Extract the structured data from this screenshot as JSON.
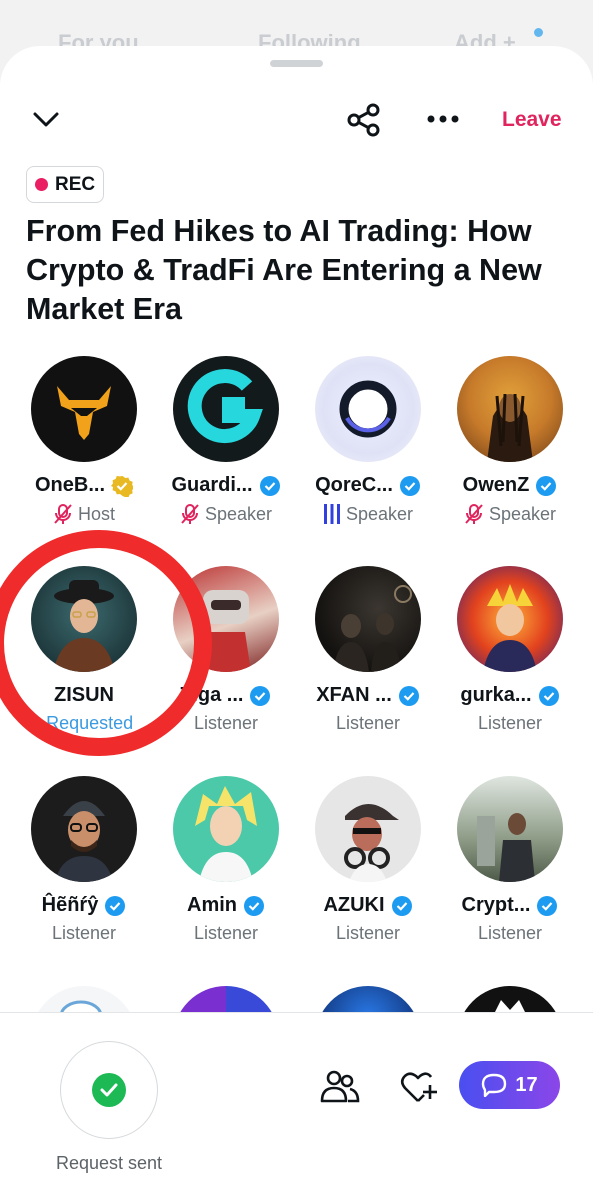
{
  "top_tabs": [
    "For you",
    "Following",
    "Add +"
  ],
  "header": {
    "leave_label": "Leave"
  },
  "rec_label": "REC",
  "space_title": "From Fed Hikes to AI Trading: How Crypto & TradFi Are Entering a New Market Era",
  "participants": [
    {
      "name": "OneB...",
      "role": "Host",
      "badge": "gold-check",
      "mic": "muted"
    },
    {
      "name": "Guardi...",
      "role": "Speaker",
      "badge": "blue-check",
      "mic": "muted"
    },
    {
      "name": "QoreC...",
      "role": "Speaker",
      "badge": "blue-check",
      "mic": "speaking"
    },
    {
      "name": "OwenZ",
      "role": "Speaker",
      "badge": "blue-check",
      "mic": "muted"
    },
    {
      "name": "ZISUN",
      "role": "• Requested",
      "badge": "",
      "mic": ""
    },
    {
      "name": "Tiga ...",
      "role": "Listener",
      "badge": "blue-check",
      "mic": ""
    },
    {
      "name": "XFAN ...",
      "role": "Listener",
      "badge": "blue-check",
      "mic": ""
    },
    {
      "name": "gurka...",
      "role": "Listener",
      "badge": "blue-check",
      "mic": ""
    },
    {
      "name": "Ĥẽñŕŷ",
      "role": "Listener",
      "badge": "blue-check",
      "mic": ""
    },
    {
      "name": "Amin",
      "role": "Listener",
      "badge": "blue-check",
      "mic": ""
    },
    {
      "name": "AZUKI",
      "role": "Listener",
      "badge": "blue-check",
      "mic": ""
    },
    {
      "name": "Crypt...",
      "role": "Listener",
      "badge": "blue-check",
      "mic": ""
    }
  ],
  "bottom": {
    "request_label": "Request sent",
    "chat_count": "17"
  },
  "colors": {
    "leave": "#e0245e",
    "verified": "#1d9bf0",
    "gold": "#e8b923",
    "requested": "#3b9ae0",
    "muted_mic": "#e0245e"
  }
}
